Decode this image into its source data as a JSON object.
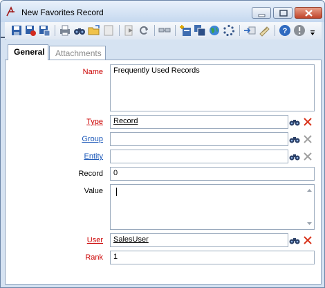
{
  "window": {
    "title": "New Favorites Record"
  },
  "icons": {
    "app": "app-logo-icon",
    "toolbar": [
      "save-icon",
      "save-delete-icon",
      "save-new-icon",
      "print-icon",
      "find-icon",
      "open-folder-icon",
      "blank-page-icon",
      "forward-icon",
      "refresh-icon",
      "link-icon",
      "new-record-icon",
      "copy-record-icon",
      "globe-icon",
      "spinner-icon",
      "import-icon",
      "attach-icon",
      "help-icon",
      "info-icon",
      "toolbar-overflow-icon"
    ]
  },
  "tabs": [
    {
      "label": "General",
      "active": true
    },
    {
      "label": "Attachments",
      "active": false
    }
  ],
  "form": {
    "name": {
      "label": "Name",
      "value": "Frequently Used Records"
    },
    "type": {
      "label": "Type",
      "value": "Record"
    },
    "group": {
      "label": "Group",
      "value": ""
    },
    "entity": {
      "label": "Entity",
      "value": ""
    },
    "record": {
      "label": "Record",
      "value": "0"
    },
    "value": {
      "label": "Value",
      "value": ""
    },
    "user": {
      "label": "User",
      "value": "SalesUser"
    },
    "rank": {
      "label": "Rank",
      "value": "1"
    }
  },
  "colors": {
    "required": "#cc0000",
    "link": "#1a57b8",
    "clear_active": "#d9341c",
    "clear_disabled": "#a0a0a0"
  }
}
